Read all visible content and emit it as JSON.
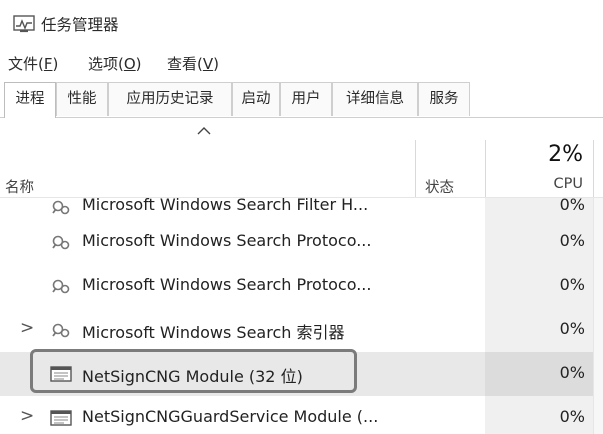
{
  "window": {
    "title": "任务管理器",
    "icon": "task-manager-icon"
  },
  "menubar": [
    {
      "text": "文件(",
      "mnemonic": "F",
      "close": ")"
    },
    {
      "text": "选项(",
      "mnemonic": "O",
      "close": ")"
    },
    {
      "text": "查看(",
      "mnemonic": "V",
      "close": ")"
    }
  ],
  "tabs": [
    "进程",
    "性能",
    "应用历史记录",
    "启动",
    "用户",
    "详细信息",
    "服务"
  ],
  "active_tab": "进程",
  "header": {
    "sort_glyph": "^",
    "name_label": "名称",
    "status_label": "状态",
    "cpu_total": "2%",
    "cpu_label": "CPU"
  },
  "rows": [
    {
      "name": "Microsoft Windows Search Filter H...",
      "cpu": "0%",
      "icon": "search-service-icon",
      "expandable": false,
      "selected": false,
      "partial": true
    },
    {
      "name": "Microsoft Windows Search Protoco...",
      "cpu": "0%",
      "icon": "search-service-icon",
      "expandable": false,
      "selected": false
    },
    {
      "name": "Microsoft Windows Search Protoco...",
      "cpu": "0%",
      "icon": "search-service-icon",
      "expandable": false,
      "selected": false
    },
    {
      "name": "Microsoft Windows Search 索引器",
      "cpu": "0%",
      "icon": "search-service-icon",
      "expandable": true,
      "selected": false
    },
    {
      "name": "NetSignCNG  Module (32 位)",
      "cpu": "0%",
      "icon": "application-window-icon",
      "expandable": false,
      "selected": true
    },
    {
      "name": "NetSignCNGGuardService Module (...",
      "cpu": "0%",
      "icon": "application-window-icon",
      "expandable": true,
      "selected": false
    }
  ],
  "expand_glyph": ">"
}
